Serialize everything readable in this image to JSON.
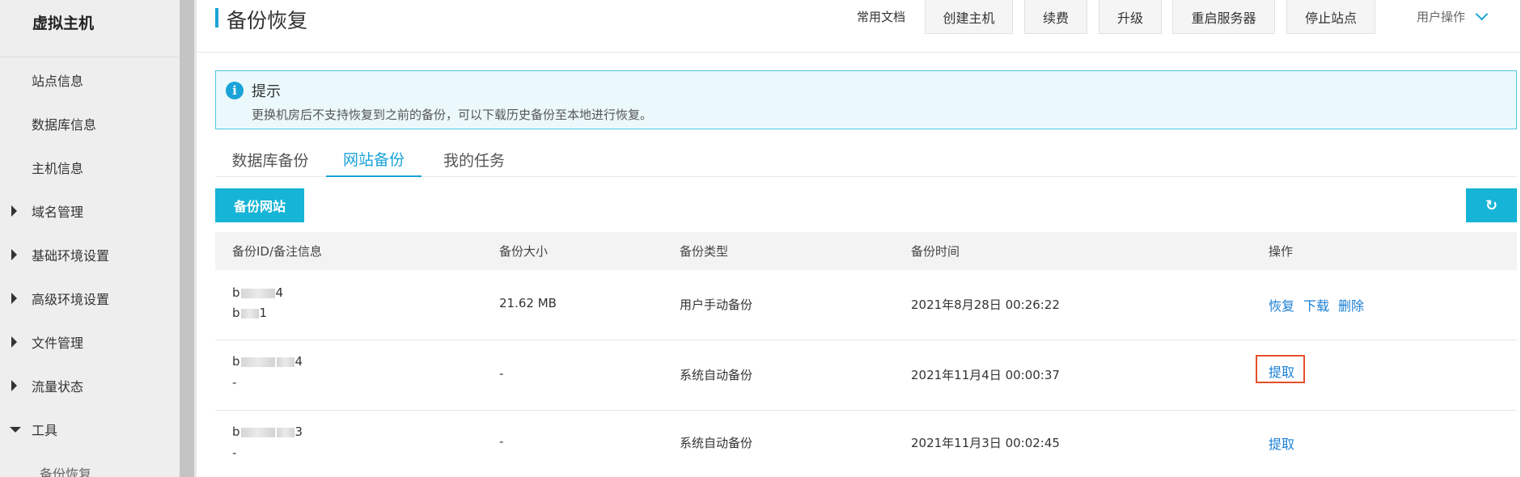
{
  "sidebar": {
    "title": "虚拟主机",
    "items": [
      {
        "label": "站点信息",
        "arrow": "none"
      },
      {
        "label": "数据库信息",
        "arrow": "none"
      },
      {
        "label": "主机信息",
        "arrow": "none"
      },
      {
        "label": "域名管理",
        "arrow": "right"
      },
      {
        "label": "基础环境设置",
        "arrow": "right"
      },
      {
        "label": "高级环境设置",
        "arrow": "right"
      },
      {
        "label": "文件管理",
        "arrow": "right"
      },
      {
        "label": "流量状态",
        "arrow": "right"
      },
      {
        "label": "工具",
        "arrow": "down"
      },
      {
        "label": "备份恢复",
        "arrow": "none"
      }
    ]
  },
  "header": {
    "title": "备份恢复",
    "doc_link": "常用文档",
    "buttons": [
      "创建主机",
      "续费",
      "升级",
      "重启服务器",
      "停止站点"
    ],
    "user_ops": "用户操作"
  },
  "notice": {
    "title": "提示",
    "text": "更换机房后不支持恢复到之前的备份，可以下载历史备份至本地进行恢复。"
  },
  "tabs": [
    {
      "label": "数据库备份",
      "active": false
    },
    {
      "label": "网站备份",
      "active": true
    },
    {
      "label": "我的任务",
      "active": false
    }
  ],
  "toolbar": {
    "backup_label": "备份网站"
  },
  "table": {
    "headers": [
      "备份ID/备注信息",
      "备份大小",
      "备份类型",
      "备份时间",
      "操作"
    ],
    "rows": [
      {
        "id_pre": "b",
        "id_suf": "4",
        "note_pre": "b",
        "note_suf": "1",
        "size": "21.62 MB",
        "type": "用户手动备份",
        "time": "2021年8月28日 00:26:22",
        "actions": [
          "恢复",
          "下载",
          "删除"
        ]
      },
      {
        "id_pre": "b",
        "id_suf": "4",
        "note": "-",
        "size": "-",
        "type": "系统自动备份",
        "time": "2021年11月4日 00:00:37",
        "actions": [
          "提取"
        ]
      },
      {
        "id_pre": "b",
        "id_suf": "3",
        "note": "-",
        "size": "-",
        "type": "系统自动备份",
        "time": "2021年11月3日 00:02:45",
        "actions": [
          "提取"
        ]
      }
    ]
  },
  "colors": {
    "accent": "#16b4d6",
    "link": "#1a7fd4",
    "highlight": "#e4502b"
  }
}
